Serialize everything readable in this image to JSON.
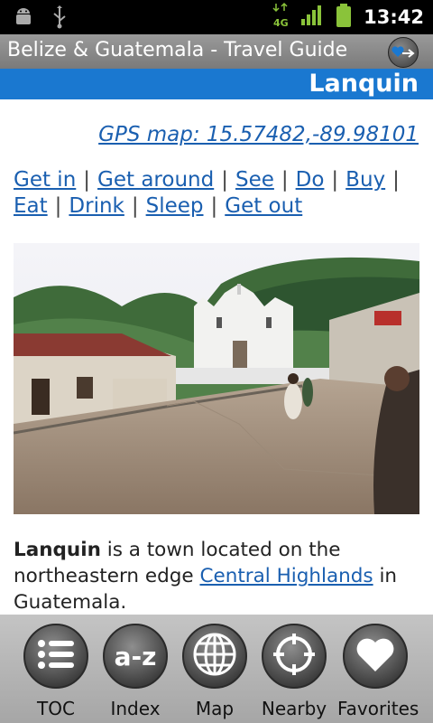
{
  "status_bar": {
    "time": "13:42",
    "icons": [
      "android-icon",
      "usb-icon",
      "4g-signal-icon",
      "signal-bars-icon",
      "battery-icon"
    ],
    "network": "4G"
  },
  "app": {
    "title": "Belize & Guatemala - Travel Guide",
    "favorite_icon": "heart-arrow-icon"
  },
  "page": {
    "title": "Lanquin",
    "gps_link": "GPS map: 15.57482,-89.98101",
    "nav_links": [
      "Get in",
      "Get around",
      "See",
      "Do",
      "Buy",
      "Eat",
      "Drink",
      "Sleep",
      "Get out"
    ],
    "nav_separator": "|",
    "paragraph": {
      "bold": "Lanquin",
      "text1": " is a town located on the northeastern edge ",
      "link": "Central Highlands",
      "text2": " in Guatemala."
    }
  },
  "toolbar": {
    "items": [
      {
        "label": "TOC",
        "icon": "list-icon"
      },
      {
        "label": "Index",
        "icon": "a-z-icon",
        "icon_text": "a-z"
      },
      {
        "label": "Map",
        "icon": "globe-icon"
      },
      {
        "label": "Nearby",
        "icon": "crosshair-icon"
      },
      {
        "label": "Favorites",
        "icon": "heart-icon"
      }
    ]
  },
  "colors": {
    "header_blue": "#1a78d0",
    "link_blue": "#1a5fb0",
    "title_bar": "#8a8a8a"
  }
}
